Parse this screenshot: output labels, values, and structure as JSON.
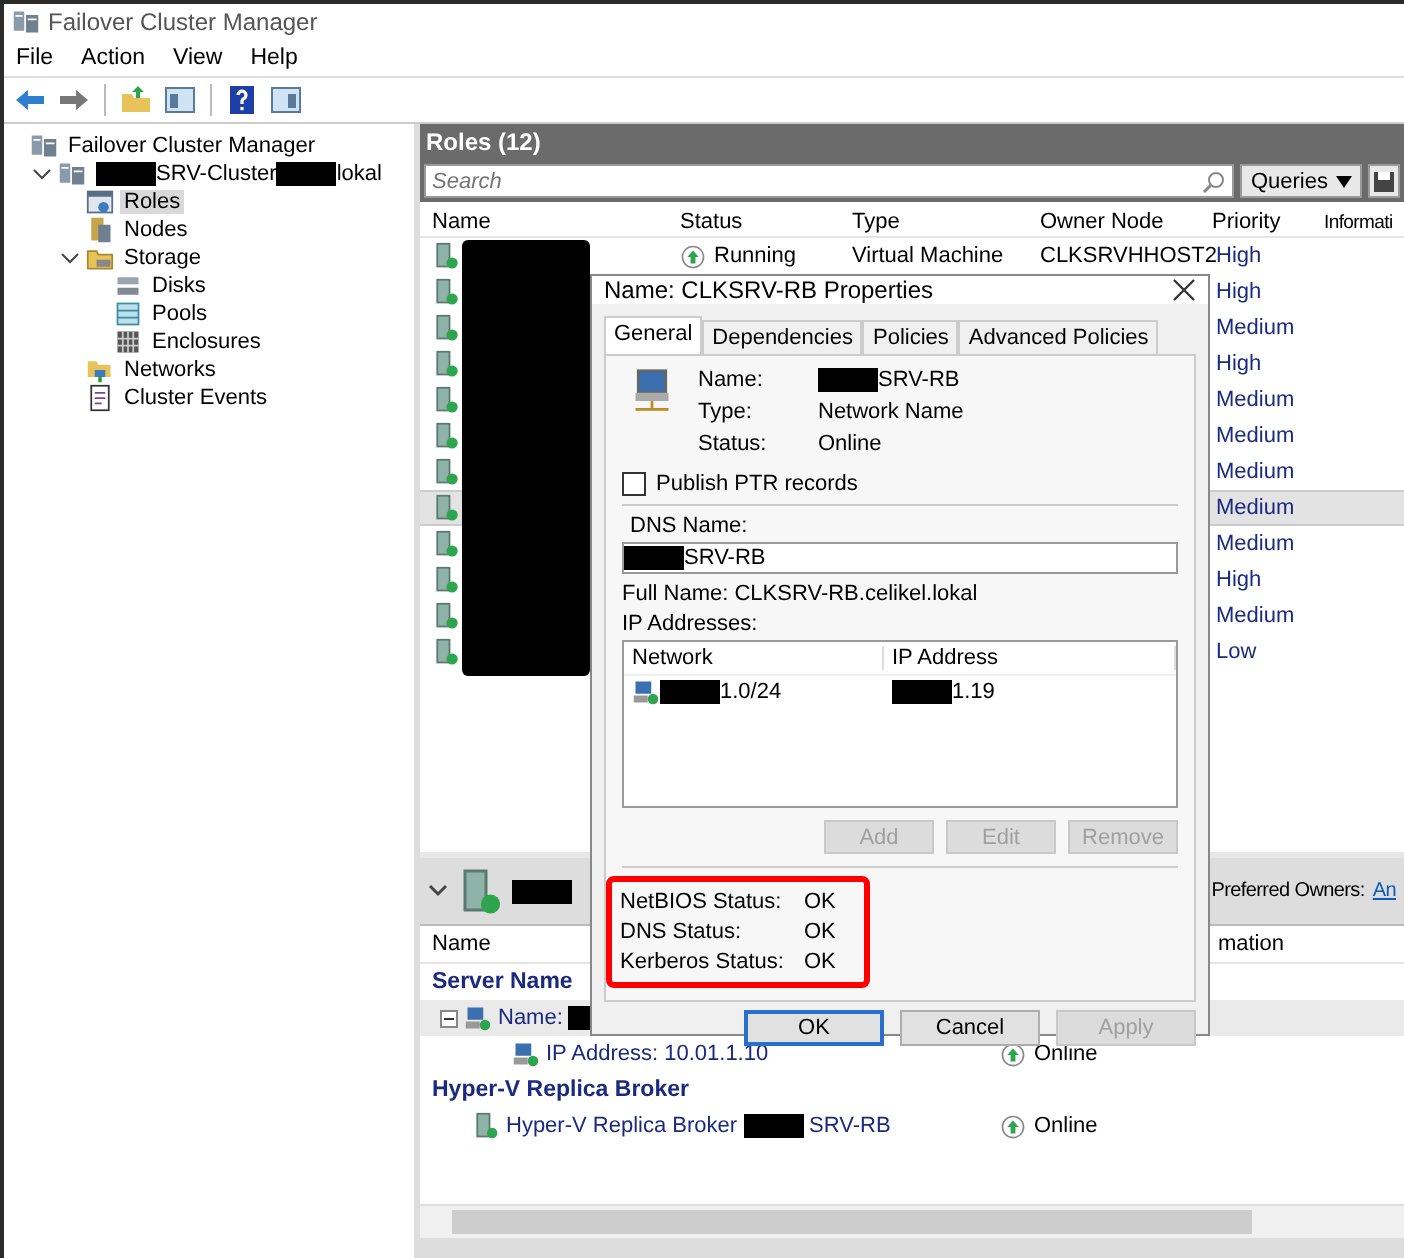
{
  "window": {
    "title": "Failover Cluster Manager"
  },
  "menu": [
    "File",
    "Action",
    "View",
    "Help"
  ],
  "toolbar": [
    {
      "kind": "back"
    },
    {
      "kind": "forward"
    },
    {
      "kind": "separator"
    },
    {
      "kind": "folder"
    },
    {
      "kind": "tree-pane"
    },
    {
      "kind": "separator"
    },
    {
      "kind": "help"
    },
    {
      "kind": "action-pane"
    }
  ],
  "tree": [
    {
      "label": [
        "Failover Cluster Manager"
      ],
      "selected": false,
      "children": [
        {
          "label": [
            {
              "kind": "redacted"
            },
            "SRV-Cluster",
            {
              "kind": "redacted"
            },
            "lokal"
          ],
          "selected": false,
          "expanded": true,
          "children": [
            {
              "label": [
                "Roles"
              ],
              "selected": true
            },
            {
              "label": [
                "Nodes"
              ],
              "selected": false
            },
            {
              "label": [
                "Storage"
              ],
              "selected": false,
              "expanded": true,
              "children": [
                {
                  "label": [
                    "Disks"
                  ],
                  "selected": false
                },
                {
                  "label": [
                    "Pools"
                  ],
                  "selected": false
                },
                {
                  "label": [
                    "Enclosures"
                  ],
                  "selected": false
                }
              ]
            },
            {
              "label": [
                "Networks"
              ],
              "selected": false
            },
            {
              "label": [
                "Cluster Events"
              ],
              "selected": false
            }
          ]
        }
      ]
    }
  ],
  "roles": {
    "title": "Roles (12)",
    "search": {
      "placeholder": "Search"
    },
    "queries": "Queries",
    "columns": [
      "Name",
      "Status",
      "Type",
      "Owner Node",
      "Priority",
      "Informati"
    ],
    "rows": [
      {
        "status": "Running",
        "type": "Virtual Machine",
        "owner": "CLKSRVHHOST2",
        "priority": "High",
        "selected": false
      },
      {
        "priority": "High",
        "selected": false
      },
      {
        "priority": "Medium",
        "selected": false
      },
      {
        "priority": "High",
        "selected": false
      },
      {
        "priority": "Medium",
        "selected": false
      },
      {
        "priority": "Medium",
        "selected": false
      },
      {
        "priority": "Medium",
        "selected": false
      },
      {
        "priority": "Medium",
        "selected": true
      },
      {
        "priority": "Medium",
        "selected": false
      },
      {
        "priority": "High",
        "selected": false
      },
      {
        "priority": "Medium",
        "selected": false
      },
      {
        "priority": "Low",
        "selected": false
      }
    ]
  },
  "details": {
    "header": {
      "name": [
        {
          "kind": "redacted"
        }
      ],
      "preferred_owners": "Preferred Owners:",
      "link": "An"
    },
    "columns": [
      "Name",
      "mation"
    ],
    "groups": [
      {
        "title": "Server Name",
        "items": [
          {
            "label": [
              "Name:",
              {
                "kind": "redacted"
              }
            ],
            "expanded": true,
            "children": [
              {
                "label": [
                  "IP Address: 10.01.1.10"
                ],
                "status": "Online"
              }
            ]
          }
        ]
      },
      {
        "title": "Hyper-V Replica Broker",
        "items": [
          {
            "label": [
              "Hyper-V Replica Broker",
              {
                "kind": "redacted"
              },
              "SRV-RB"
            ],
            "status": "Online"
          }
        ]
      }
    ]
  },
  "dialog": {
    "title": "Name: CLKSRV-RB Properties",
    "tabs": [
      {
        "label": "General",
        "selected": true
      },
      {
        "label": "Dependencies",
        "selected": false
      },
      {
        "label": "Policies",
        "selected": false
      },
      {
        "label": "Advanced Policies",
        "selected": false
      }
    ],
    "properties": [
      {
        "label": "Name:",
        "value": [
          {
            "kind": "redacted"
          },
          "SRV-RB"
        ]
      },
      {
        "label": "Type:",
        "value": [
          "Network Name"
        ]
      },
      {
        "label": "Status:",
        "value": [
          "Online"
        ]
      }
    ],
    "publish_ptr": {
      "label": "Publish PTR records",
      "checked": false
    },
    "dns_name": {
      "label": "DNS Name:",
      "value": [
        {
          "kind": "redacted"
        },
        "SRV-RB"
      ]
    },
    "full_name": "Full Name: CLKSRV-RB.celikel.lokal",
    "ip_addresses": {
      "label": "IP Addresses:",
      "columns": [
        "Network",
        "IP Address"
      ],
      "rows": [
        {
          "network": [
            {
              "kind": "redacted"
            },
            "1.0/24"
          ],
          "ip": [
            {
              "kind": "redacted"
            },
            "1.19"
          ]
        }
      ]
    },
    "ip_buttons": [
      {
        "label": "Add",
        "disabled": true
      },
      {
        "label": "Edit",
        "disabled": true
      },
      {
        "label": "Remove",
        "disabled": true
      }
    ],
    "statuses": [
      {
        "label": "NetBIOS Status:",
        "value": "OK"
      },
      {
        "label": "DNS Status:",
        "value": "OK"
      },
      {
        "label": "Kerberos Status:",
        "value": "OK"
      }
    ],
    "buttons": [
      {
        "label": "OK",
        "default": true,
        "disabled": false
      },
      {
        "label": "Cancel",
        "default": false,
        "disabled": false
      },
      {
        "label": "Apply",
        "default": false,
        "disabled": true
      }
    ]
  }
}
